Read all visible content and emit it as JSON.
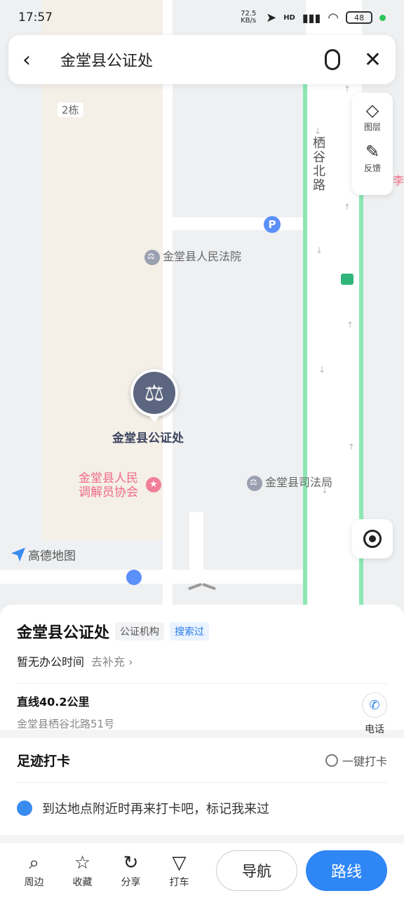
{
  "status": {
    "time": "17:57",
    "net_speed": "72.5 KB/s",
    "network": "HD",
    "battery": "48"
  },
  "search": {
    "query": "金堂县公证处"
  },
  "map": {
    "labels": {
      "building": "2栋",
      "road": "栖谷北路",
      "court": "金堂县人民法院",
      "pin": "金堂县公证处",
      "mediation": "金堂县人民调解员协会",
      "justice": "金堂县司法局",
      "edge": "李"
    },
    "brand": "高德地图",
    "colors": {
      "road_green": "#8ce8b3",
      "pin": "#5d6680",
      "accent": "#2f86f5"
    }
  },
  "tools": {
    "layers": "图层",
    "feedback": "反馈"
  },
  "place": {
    "name": "金堂县公证处",
    "tags": [
      "公证机构",
      "搜索过"
    ],
    "hours": "暂无办公时间",
    "fill_hours": "去补充",
    "distance": "直线40.2公里",
    "address": "金堂县栖谷北路51号",
    "phone_label": "电话"
  },
  "footprint": {
    "title": "足迹打卡",
    "checkin_button": "一键打卡",
    "hint": "到达地点附近时再来打卡吧，标记我来过"
  },
  "bottom_bar": {
    "items": [
      "周边",
      "收藏",
      "分享",
      "打车"
    ],
    "nav_button": "导航",
    "route_button": "路线"
  }
}
